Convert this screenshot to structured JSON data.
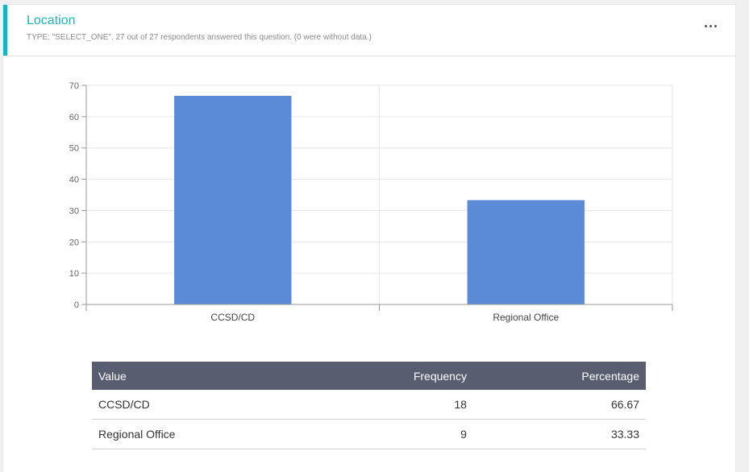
{
  "card": {
    "title": "Location",
    "subtitle": "TYPE: \"SELECT_ONE\". 27 out of 27 respondents answered this question. (0 were without data.)",
    "more_icon": "more-horizontal-icon"
  },
  "colors": {
    "accent": "#1ab3c2",
    "bar": "#5b8ad6",
    "table_header": "#585e70"
  },
  "chart_data": {
    "type": "bar",
    "categories": [
      "CCSD/CD",
      "Regional Office"
    ],
    "values": [
      66.67,
      33.33
    ],
    "ylim": [
      0,
      70
    ],
    "yticks": [
      0,
      10,
      20,
      30,
      40,
      50,
      60,
      70
    ],
    "grid": true,
    "title": "",
    "xlabel": "",
    "ylabel": ""
  },
  "table": {
    "headers": {
      "value": "Value",
      "frequency": "Frequency",
      "percentage": "Percentage"
    },
    "rows": [
      {
        "value": "CCSD/CD",
        "frequency": "18",
        "percentage": "66.67"
      },
      {
        "value": "Regional Office",
        "frequency": "9",
        "percentage": "33.33"
      }
    ]
  }
}
